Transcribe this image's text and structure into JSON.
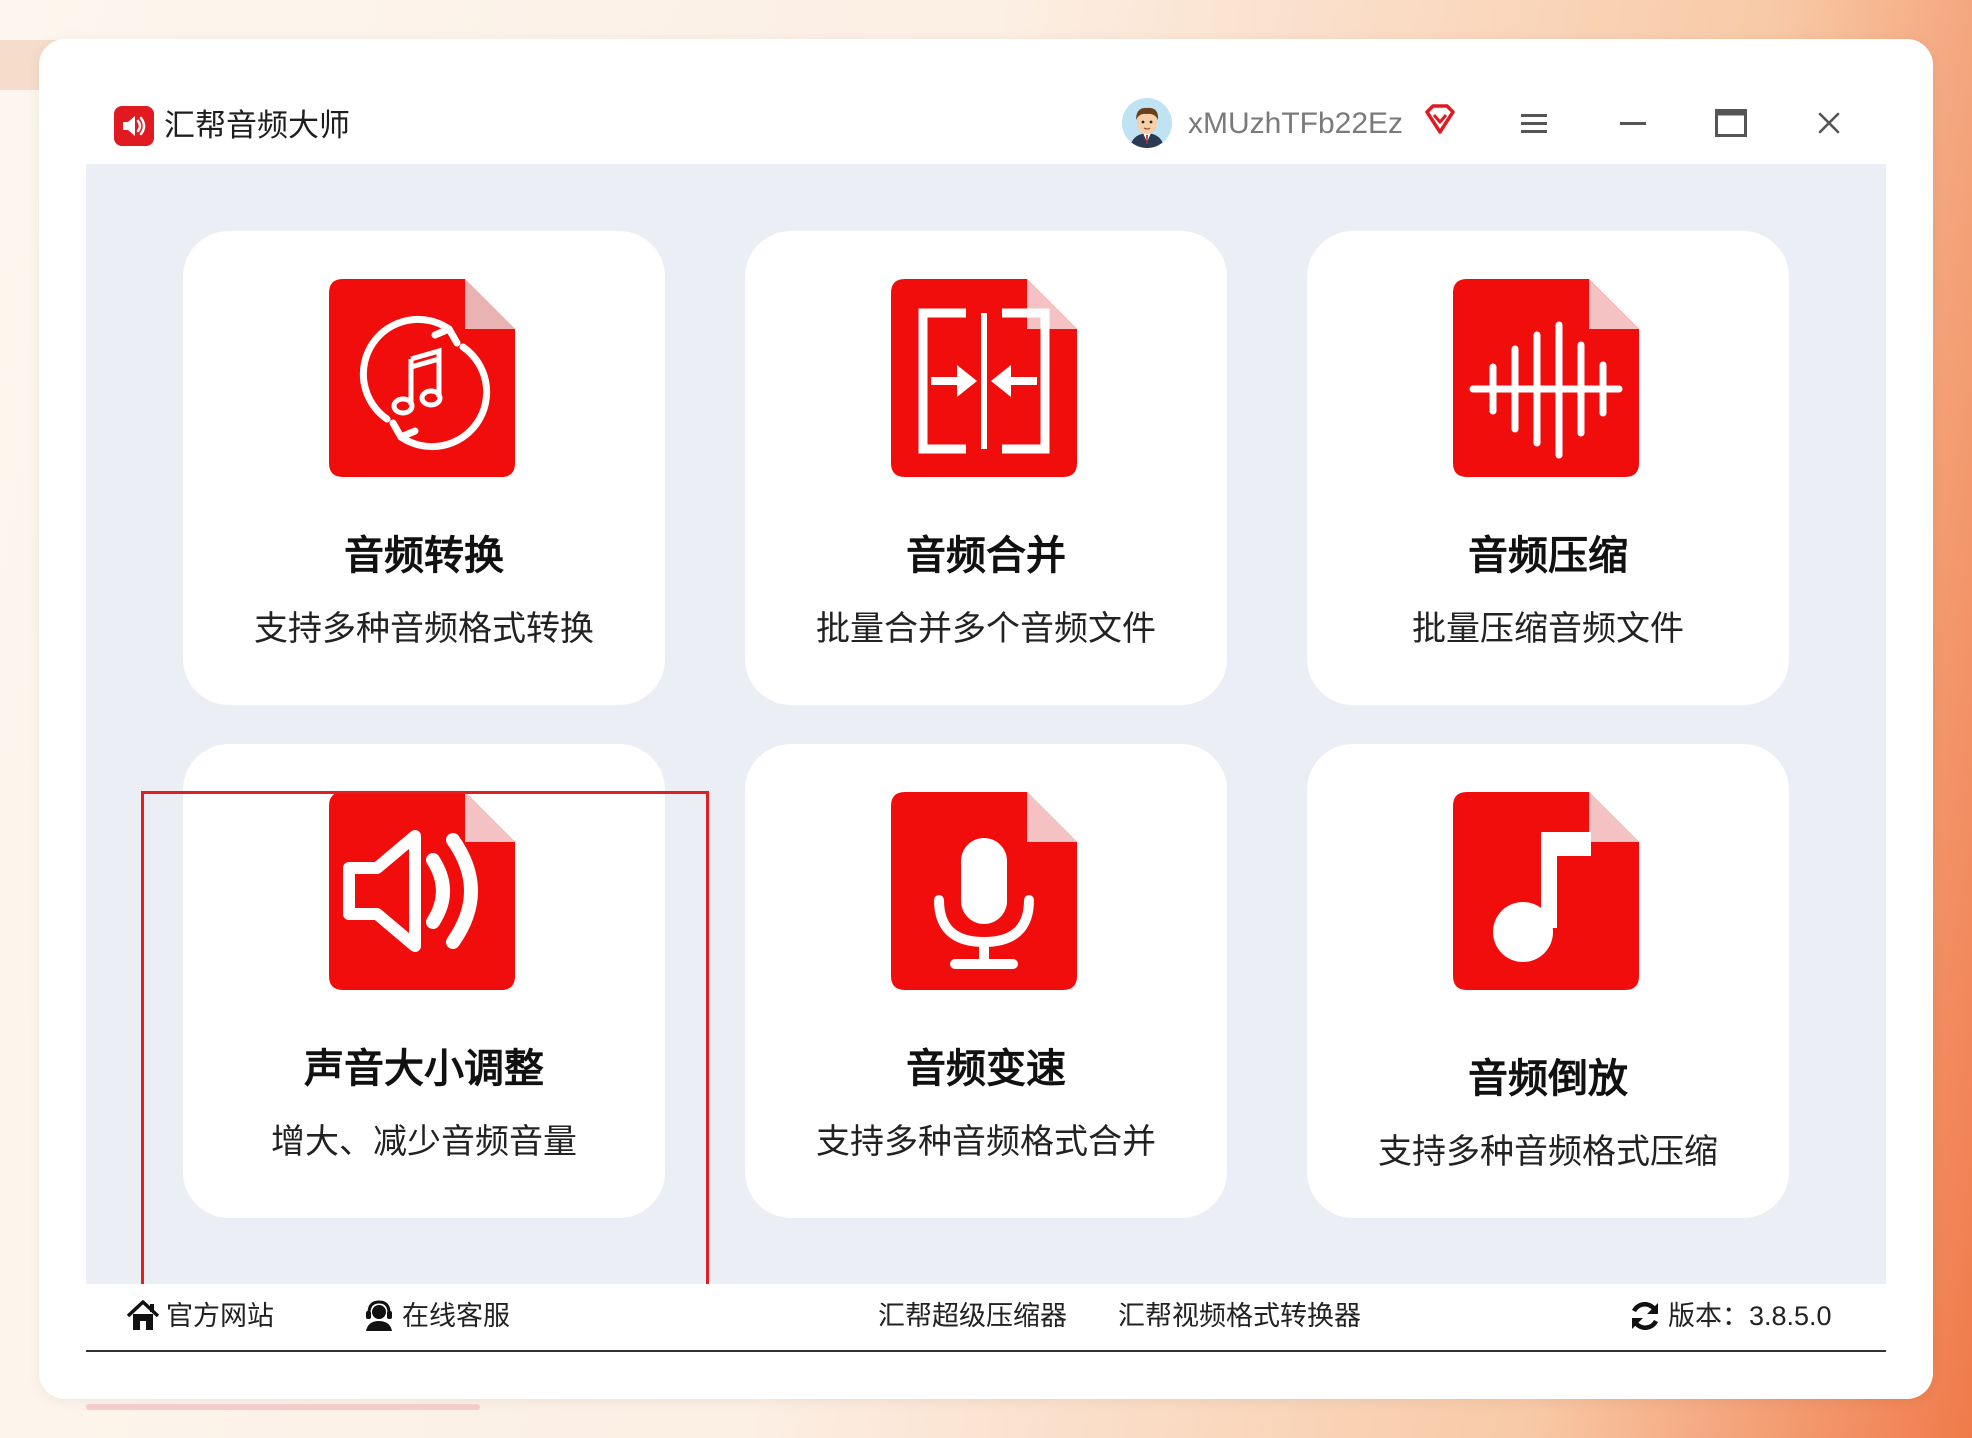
{
  "app": {
    "title": "汇帮音频大师"
  },
  "user": {
    "name": "xMUzhTFb22Ez"
  },
  "icons": {
    "logo": "speaker-icon",
    "vip": "vip-diamond-icon",
    "menu": "menu-icon",
    "minimize": "minimize-icon",
    "maximize": "maximize-icon",
    "close": "close-icon"
  },
  "colors": {
    "accent": "#e11a22",
    "icon_red": "#f20d0d",
    "main_bg": "#eceef5",
    "highlight": "#e02020"
  },
  "tools": [
    {
      "title": "音频转换",
      "desc": "支持多种音频格式转换",
      "icon": "audio-convert-icon"
    },
    {
      "title": "音频合并",
      "desc": "批量合并多个音频文件",
      "icon": "audio-merge-icon"
    },
    {
      "title": "音频压缩",
      "desc": "批量压缩音频文件",
      "icon": "audio-compress-icon"
    },
    {
      "title": "声音大小调整",
      "desc": "增大、减少音频音量",
      "icon": "volume-icon"
    },
    {
      "title": "音频变速",
      "desc": "支持多种音频格式合并",
      "icon": "microphone-icon"
    },
    {
      "title": "音频倒放",
      "desc": "支持多种音频格式压缩",
      "icon": "music-note-icon"
    }
  ],
  "footer": {
    "website": "官方网站",
    "support": "在线客服",
    "link1": "汇帮超级压缩器",
    "link2": "汇帮视频格式转换器",
    "version": "版本：3.8.5.0"
  }
}
